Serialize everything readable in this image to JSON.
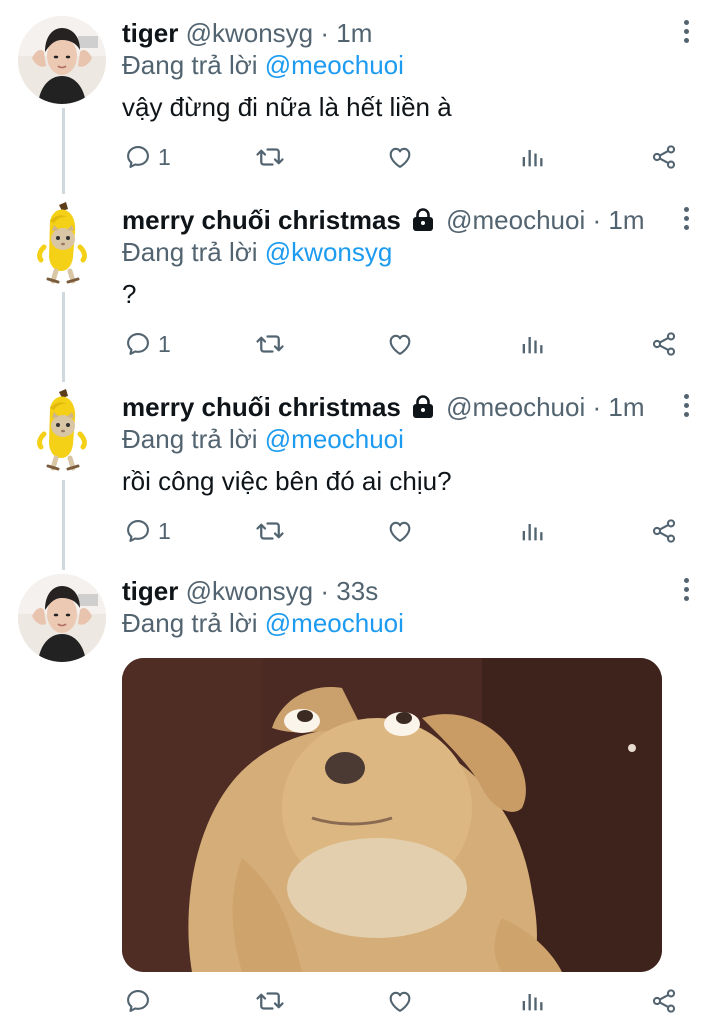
{
  "tweets": [
    {
      "name": "tiger",
      "handle": "@kwonsyg",
      "time": "1m",
      "dot": "·",
      "reply_prefix": "Đang trả lời ",
      "reply_to": "@meochuoi",
      "text": "vậy đừng đi nữa là hết liền à",
      "reply_count": "1",
      "avatar": "person-avatar",
      "protected": false
    },
    {
      "name": "merry chuối christmas",
      "handle": "@meochuoi",
      "time": "1m",
      "dot": "·",
      "reply_prefix": "Đang trả lời ",
      "reply_to": "@kwonsyg",
      "text": "?",
      "reply_count": "1",
      "avatar": "banana-cat-avatar",
      "protected": true
    },
    {
      "name": "merry chuối christmas",
      "handle": "@meochuoi",
      "time": "1m",
      "dot": "·",
      "reply_prefix": "Đang trả lời ",
      "reply_to": "@meochuoi",
      "text": "rồi công việc bên đó ai chịu?",
      "reply_count": "1",
      "avatar": "banana-cat-avatar",
      "protected": true
    },
    {
      "name": "tiger",
      "handle": "@kwonsyg",
      "time": "33s",
      "dot": "·",
      "reply_prefix": "Đang trả lời ",
      "reply_to": "@meochuoi",
      "text": "",
      "reply_count": "",
      "avatar": "person-avatar",
      "protected": false,
      "media": "dog-photo"
    }
  ],
  "colors": {
    "accent": "#1d9bf0",
    "secondary_text": "#536471",
    "thread_line": "#cfd9de"
  }
}
